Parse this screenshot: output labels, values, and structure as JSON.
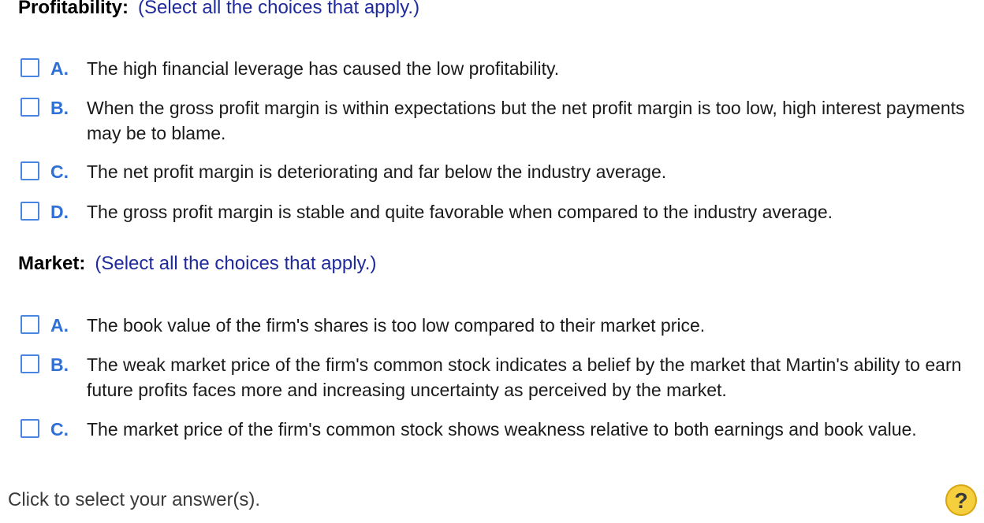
{
  "profitability": {
    "label": "Profitability:",
    "instruction": "(Select all the choices that apply.)",
    "choices": [
      {
        "letter": "A.",
        "text": "The high financial leverage has caused the low profitability."
      },
      {
        "letter": "B.",
        "text": "When the gross profit margin is within expectations but the net profit margin is too low, high interest payments may be to blame."
      },
      {
        "letter": "C.",
        "text": "The net profit margin is deteriorating and far below the industry average."
      },
      {
        "letter": "D.",
        "text": "The gross profit margin is stable and quite favorable when compared to the industry average."
      }
    ]
  },
  "market": {
    "label": "Market:",
    "instruction": "(Select all the choices that apply.)",
    "choices": [
      {
        "letter": "A.",
        "text": "The book value of the firm's shares is too low compared to their market price."
      },
      {
        "letter": "B.",
        "text": "The weak market price of the firm's common stock indicates a belief by the market that Martin's ability to earn future profits faces more and increasing uncertainty as perceived by the market."
      },
      {
        "letter": "C.",
        "text": "The market price of the firm's common stock shows weakness relative to both earnings and book value."
      }
    ]
  },
  "footer": {
    "prompt": "Click to select your answer(s).",
    "help_label": "?"
  }
}
